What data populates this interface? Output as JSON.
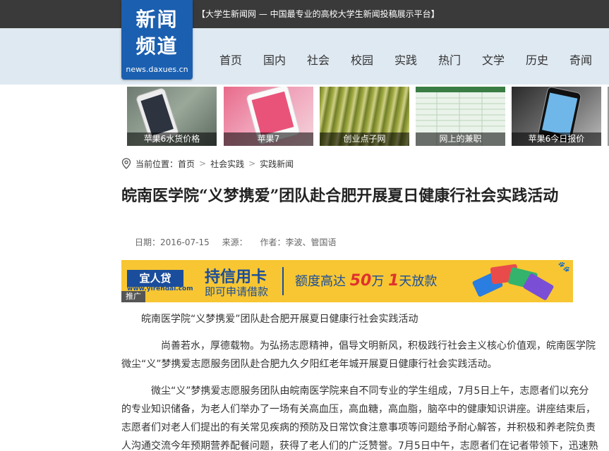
{
  "header": {
    "slogan": "【大学生新闻网 — 中国最专业的高校大学生新闻投稿展示平台】",
    "logo": {
      "line1": "新闻",
      "line2": "频道",
      "url": "news.daxues.cn"
    },
    "nav": [
      "首页",
      "国内",
      "社会",
      "校园",
      "实践",
      "热门",
      "文学",
      "历史",
      "奇闻"
    ]
  },
  "thumbnails": [
    {
      "caption": "苹果6水货价格"
    },
    {
      "caption": "苹果7"
    },
    {
      "caption": "创业点子网"
    },
    {
      "caption": "网上的兼职"
    },
    {
      "caption": "苹果6今日报价"
    }
  ],
  "breadcrumb": {
    "label": "当前位置：",
    "items": [
      "首页",
      "社会实践",
      "实践新闻"
    ]
  },
  "article": {
    "title": "皖南医学院“义梦携爱”团队赴合肥开展夏日健康行社会实践活动",
    "date_label": "日期：",
    "date": "2016-07-15",
    "source_label": "来源：",
    "author_label": "作者：",
    "author": "李波、管国语",
    "paragraphs": [
      "皖南医学院“义梦携爱”团队赴合肥开展夏日健康行社会实践活动",
      "尚善若水，厚德载物。为弘扬志愿精神，倡导文明新风，积极践行社会主义核心价值观，皖南医学院微尘“义”梦携爱志愿服务团队赴合肥九久夕阳红老年城开展夏日健康行社会实践活动。",
      "微尘“义”梦携爱志愿服务团队由皖南医学院来自不同专业的学生组成，7月5日上午，志愿者们以充分的专业知识储备，为老人们举办了一场有关高血压，高血糖，高血脂，脑卒中的健康知识讲座。讲座结束后，志愿者们对老人们提出的有关常见疾病的预防及日常饮食注意事项等问题给予耐心解答，并积极和养老院负责人沟通交流今年预期营养配餐问题，获得了老人们的广泛赞誉。7月5日中午，志愿者们在记者带领下，迅速熟"
    ]
  },
  "ad": {
    "brand": "宜人贷",
    "brand_url": "www.yirendai.com",
    "tag": "推广",
    "main": "持信用卡",
    "sub": "即可申请借款",
    "offer_pre": "额度高达",
    "offer_amount": "50",
    "offer_unit": "万",
    "offer_days": "1",
    "offer_post": "天放款",
    "paw_icon": "paw-icon"
  },
  "colors": {
    "topbar": "#3a3a3a",
    "navband": "#dfe9f2",
    "logo": "#1b5fb0",
    "ad_bg": "#f7c632",
    "ad_text": "#1a4d9c",
    "ad_accent": "#e0312e"
  }
}
